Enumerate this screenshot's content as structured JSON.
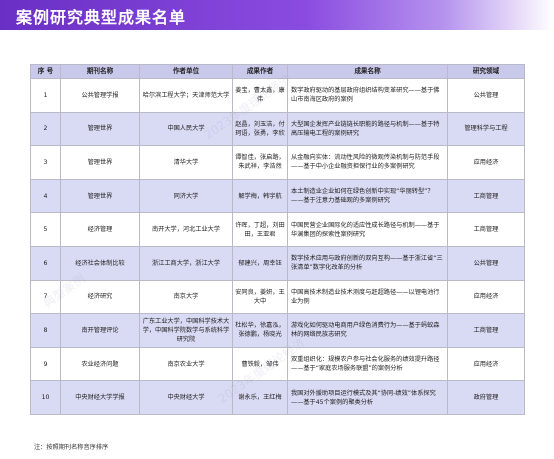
{
  "title": "案例研究典型成果名单",
  "headers": [
    "序 号",
    "期刊名称",
    "作者单位",
    "成果作者",
    "成果名称",
    "研究领域"
  ],
  "rows": [
    {
      "no": "1",
      "journal": "公共管理学报",
      "unit": "哈尔滨工程大学；天津师范大学",
      "authors": "姜宝，曹太鑫，康伟",
      "paper": "数字政府驱动的基层政府组织结构变革研究——基于佛山市南海区政府的案例",
      "field": "公共管理"
    },
    {
      "no": "2",
      "journal": "管理世界",
      "unit": "中国人民大学",
      "authors": "赵晶，刘玉洁，付珂语，张勇，李欣",
      "paper": "大型国企发挥产业链链长职能的路径与机制——基于特高压输电工程的案例研究",
      "field": "管理科学与工程"
    },
    {
      "no": "3",
      "journal": "管理世界",
      "unit": "清华大学",
      "authors": "谭智佳，张启路，朱武祥，李浩然",
      "paper": "从金融向实体：流动性风险的微观传染机制与防范手段——基于中小企业融资担保行业的多案例研究",
      "field": "应用经济"
    },
    {
      "no": "4",
      "journal": "管理世界",
      "unit": "同济大学",
      "authors": "解学梅，韩宇航",
      "paper": "本土制造业企业如何在绿色创新中实现“华丽转型”？——基于注意力基础观的多案例研究",
      "field": "工商管理"
    },
    {
      "no": "5",
      "journal": "经济管理",
      "unit": "南开大学，河北工业大学",
      "authors": "许晖，丁超，刘田田，王亚君",
      "paper": "中国民营企业国际化的适应性成长路径与机制——基于华澜集团的探索性案例研究",
      "field": "工商管理"
    },
    {
      "no": "6",
      "journal": "经济社会体制比较",
      "unit": "浙江工商大学，浙江大学",
      "authors": "郁建兴，周幸钰",
      "paper": "数字技术应用与政府创新的双向互构——基于浙江省“三张清单”数字化改革的分析",
      "field": "公共管理"
    },
    {
      "no": "7",
      "journal": "经济研究",
      "unit": "南京大学",
      "authors": "安同良，姜妍，王大中",
      "paper": "中国高技术制造业技术测度与赶超路径——以锂电池行业为例",
      "field": "应用经济"
    },
    {
      "no": "8",
      "journal": "南开管理评论",
      "unit": "广东工业大学，中国科学技术大学，中国科学院数学与系统科学研究院",
      "authors": "杜松华，徐嘉泓，张德鹏，杨晓光",
      "paper": "游戏化如何驱动电商用户绿色消费行为——基于蚂蚁森林的网络民族志研究",
      "field": "工商管理"
    },
    {
      "no": "9",
      "journal": "农业经济问题",
      "unit": "南京农业大学",
      "authors": "曹铁毅，邹伟",
      "paper": "双重组织化：规模农户参与社会化服务的绩效提升路径——基于“家庭农场服务联盟”的案例分析",
      "field": "应用经济"
    },
    {
      "no": "10",
      "journal": "中央财经大学学报",
      "unit": "中央财经大学",
      "authors": "谢永乐，王红梅",
      "paper": "我国对外援助项目运行模式及其“协同-绩效”体系探究——基于45个案例的聚类分析",
      "field": "政府管理"
    }
  ],
  "note": "注：按照期刊名称音序排序",
  "watermarks": [
    "2023年度理论经济",
    "典型案例",
    "2023年度理论经济"
  ]
}
